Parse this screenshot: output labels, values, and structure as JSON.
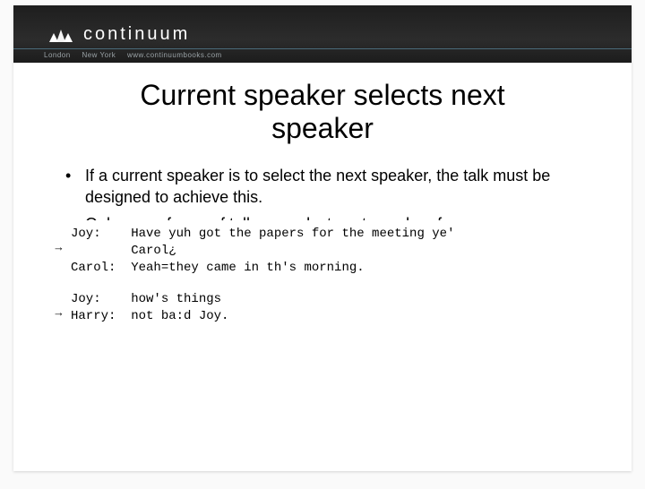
{
  "header": {
    "brand": "continuum",
    "subheader": {
      "city1": "London",
      "city2": "New York",
      "url": "www.continuumbooks.com"
    }
  },
  "slide": {
    "title": "Current speaker selects next speaker",
    "bullets": [
      "If a current speaker is to select the next speaker, the talk must be designed to achieve this.",
      "Only some forms of talk can select next speaker; for"
    ]
  },
  "transcript": {
    "block1": {
      "line1": "Joy:    Have yuh got the papers for the meeting ye'",
      "line2": "        Carol¿",
      "line3": "Carol:  Yeah=they came in th's morning."
    },
    "block2": {
      "line1": "Joy:    how's things",
      "line2": "Harry:  not ba:d Joy."
    },
    "arrow": "→"
  }
}
